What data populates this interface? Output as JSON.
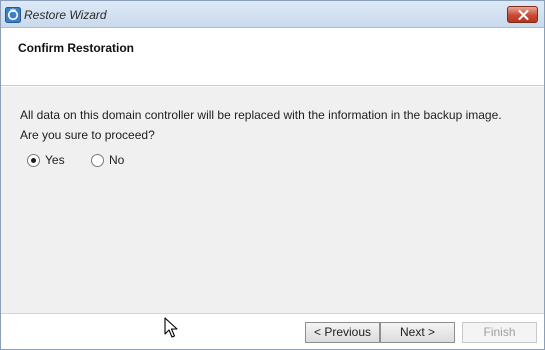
{
  "window": {
    "title": "Restore Wizard",
    "app_icon": "restore-wizard-icon",
    "close_icon": "close-icon",
    "accent_color": "#c94a34"
  },
  "header": {
    "title": "Confirm Restoration"
  },
  "content": {
    "message": "All data on this domain controller will be replaced with the information in the backup image.",
    "question": "Are you sure to proceed?",
    "options": [
      {
        "label": "Yes",
        "selected": true
      },
      {
        "label": "No",
        "selected": false
      }
    ]
  },
  "footer": {
    "previous_label": "< Previous",
    "next_label": "Next >",
    "finish_label": "Finish",
    "finish_enabled": false
  },
  "cursor": "mouse-pointer-icon"
}
